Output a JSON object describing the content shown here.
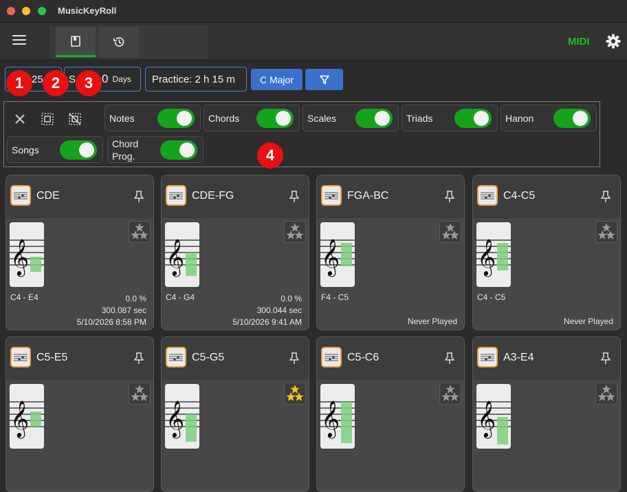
{
  "window": {
    "title": "MusicKeyRoll"
  },
  "toolbar": {
    "midi_label": "MIDI"
  },
  "info_bar": {
    "pill1_text": "25",
    "pill2_prefix": "S",
    "pill2_value": "0",
    "pill2_unit": "Days",
    "practice": "Practice: 2 h 15 m",
    "key_button": "C Major"
  },
  "badges": [
    "1",
    "2",
    "3",
    "4"
  ],
  "filters": [
    {
      "label": "Notes",
      "on": true
    },
    {
      "label": "Chords",
      "on": true
    },
    {
      "label": "Scales",
      "on": true
    },
    {
      "label": "Triads",
      "on": true
    },
    {
      "label": "Hanon",
      "on": true
    },
    {
      "label": "Songs",
      "on": true
    },
    {
      "label": "Chord Prog.",
      "on": true
    }
  ],
  "cards": [
    {
      "title": "CDE",
      "range": "C4 - E4",
      "percent": "0.0 %",
      "time": "300.087 sec",
      "date": "5/10/2026 8:58 PM",
      "status": "",
      "starred": false
    },
    {
      "title": "CDE-FG",
      "range": "C4 - G4",
      "percent": "0.0 %",
      "time": "300.044 sec",
      "date": "5/10/2026 9:41 AM",
      "status": "",
      "starred": false
    },
    {
      "title": "FGA-BC",
      "range": "F4 - C5",
      "percent": "",
      "time": "",
      "date": "",
      "status": "Never Played",
      "starred": false
    },
    {
      "title": "C4-C5",
      "range": "C4 - C5",
      "percent": "",
      "time": "",
      "date": "",
      "status": "Never Played",
      "starred": false
    },
    {
      "title": "C5-E5",
      "range": "",
      "percent": "",
      "time": "",
      "date": "",
      "status": "",
      "starred": false
    },
    {
      "title": "C5-G5",
      "range": "",
      "percent": "",
      "time": "",
      "date": "",
      "status": "",
      "starred": true
    },
    {
      "title": "C5-C6",
      "range": "",
      "percent": "",
      "time": "",
      "date": "",
      "status": "",
      "starred": false
    },
    {
      "title": "A3-E4",
      "range": "",
      "percent": "",
      "time": "",
      "date": "",
      "status": "",
      "starred": false
    }
  ],
  "colors": {
    "accent_green": "#15a31b",
    "accent_blue": "#3b70cc",
    "badge_red": "#e81010",
    "card_border_orange": "#f0a23a"
  }
}
